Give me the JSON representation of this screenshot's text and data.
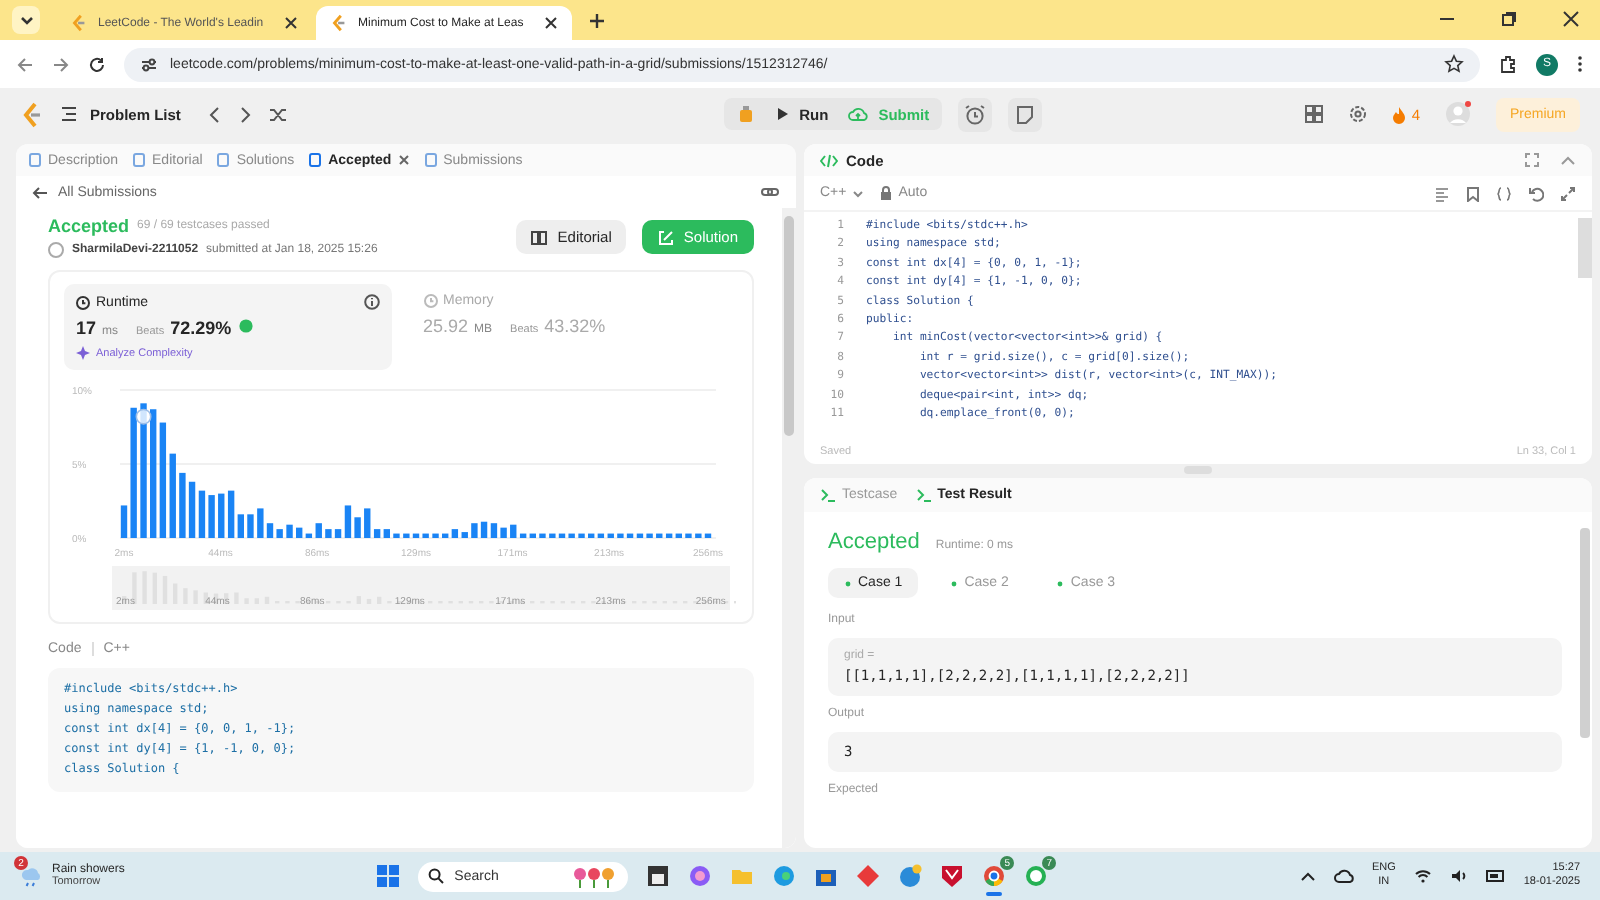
{
  "browser": {
    "tabs": [
      {
        "title": "LeetCode - The World's Leadin",
        "selected": false
      },
      {
        "title": "Minimum Cost to Make at Leas",
        "selected": true
      }
    ],
    "url": "leetcode.com/problems/minimum-cost-to-make-at-least-one-valid-path-in-a-grid/submissions/1512312746/",
    "profile": "S"
  },
  "toolbar": {
    "problem_list": "Problem List",
    "run": "Run",
    "submit": "Submit",
    "streak": "4",
    "premium": "Premium"
  },
  "left_panel": {
    "tabs": [
      {
        "label": "Description",
        "selected": false,
        "closable": false
      },
      {
        "label": "Editorial",
        "selected": false,
        "closable": false
      },
      {
        "label": "Solutions",
        "selected": false,
        "closable": false
      },
      {
        "label": "Accepted",
        "selected": true,
        "closable": true
      },
      {
        "label": "Submissions",
        "selected": false,
        "closable": false
      }
    ],
    "back_link": "All Submissions",
    "submission": {
      "status": "Accepted",
      "testcases": "69 / 69 testcases passed",
      "user": "SharmilaDevi-2211052",
      "submitted": "submitted at Jan 18, 2025 15:26",
      "editorial": "Editorial",
      "solution": "Solution"
    },
    "stats": [
      {
        "label": "Runtime",
        "value": "17",
        "unit": "ms",
        "beats_label": "Beats",
        "beats": "72.29%",
        "selected": true,
        "analyze": "Analyze Complexity"
      },
      {
        "label": "Memory",
        "value": "25.92",
        "unit": "MB",
        "beats_label": "Beats",
        "beats": "43.32%",
        "selected": false
      }
    ],
    "chart_data": {
      "type": "bar",
      "values": [
        2.2,
        8.8,
        9.1,
        8.7,
        7.8,
        5.7,
        4.4,
        3.8,
        3.2,
        2.9,
        3.0,
        3.2,
        1.6,
        1.6,
        2.0,
        1.0,
        0.6,
        0.9,
        0.7,
        0.3,
        1.0,
        0.6,
        0.6,
        2.2,
        1.4,
        2.0,
        0.6,
        0.6,
        0.3,
        0.3,
        0.3,
        0.3,
        0.3,
        0.3,
        0.6,
        0.4,
        1.0,
        1.1,
        1.0,
        0.7,
        0.9,
        0.3,
        0.3,
        0.3,
        0.3,
        0.3,
        0.3,
        0.3,
        0.3,
        0.3,
        0.3,
        0.3,
        0.3,
        0.3,
        0.3,
        0.3,
        0.3,
        0.3,
        0.3,
        0.3,
        0.3
      ],
      "x": [
        2,
        6.2,
        10.5,
        14.7,
        18.9,
        23.2,
        27.4,
        31.6,
        35.9,
        40.1,
        44.3,
        48.6,
        52.8,
        57.0,
        61.3,
        65.5,
        69.7,
        74.0,
        78.2,
        82.4,
        86.7,
        90.9,
        95.1,
        99.4,
        103.6,
        107.8,
        112.1,
        116.3,
        120.5,
        124.8,
        129.0,
        133.2,
        137.5,
        141.7,
        145.9,
        150.2,
        154.4,
        158.6,
        162.9,
        167.1,
        171.3,
        175.6,
        179.8,
        184.0,
        188.3,
        192.5,
        196.7,
        201.0,
        205.2,
        209.4,
        213.7,
        217.9,
        222.1,
        226.4,
        230.6,
        234.8,
        239.1,
        243.3,
        247.5,
        251.8,
        256
      ],
      "xlim": [
        2,
        256
      ],
      "ylim": [
        0,
        10
      ],
      "yticks": [
        {
          "value": 0,
          "label": "0%"
        },
        {
          "value": 5,
          "label": "5%"
        },
        {
          "value": 10,
          "label": "10%"
        }
      ],
      "xticks": [
        {
          "value": 2,
          "label": "2ms"
        },
        {
          "value": 44,
          "label": "44ms"
        },
        {
          "value": 86,
          "label": "86ms"
        },
        {
          "value": 129,
          "label": "129ms"
        },
        {
          "value": 171,
          "label": "171ms"
        },
        {
          "value": 213,
          "label": "213ms"
        },
        {
          "value": 256,
          "label": "256ms"
        }
      ]
    },
    "overview_labels": [
      "2ms",
      "44ms",
      "86ms",
      "129ms",
      "171ms",
      "213ms",
      "256ms"
    ],
    "code": {
      "title": "Code",
      "language": "C++",
      "lines": [
        "#include <bits/stdc++.h>",
        "using namespace std;",
        "const int dx[4] = {0, 0, 1, -1};",
        "const int dy[4] = {1, -1, 0, 0};",
        "class Solution {"
      ]
    }
  },
  "editor": {
    "title": "Code",
    "language": "C++",
    "mode": "Auto",
    "lines": [
      {
        "n": "1",
        "code": "#include <bits/stdc++.h>"
      },
      {
        "n": "2",
        "code": "using namespace std;"
      },
      {
        "n": "3",
        "code": "const int dx[4] = {0, 0, 1, -1};"
      },
      {
        "n": "4",
        "code": "const int dy[4] = {1, -1, 0, 0};"
      },
      {
        "n": "5",
        "code": "class Solution {"
      },
      {
        "n": "6",
        "code": "public:"
      },
      {
        "n": "7",
        "code": "    int minCost(vector<vector<int>>& grid) {"
      },
      {
        "n": "8",
        "code": "        int r = grid.size(), c = grid[0].size();"
      },
      {
        "n": "9",
        "code": "        vector<vector<int>> dist(r, vector<int>(c, INT_MAX));"
      },
      {
        "n": "10",
        "code": "        deque<pair<int, int>> dq;"
      },
      {
        "n": "11",
        "code": "        dq.emplace_front(0, 0);"
      }
    ],
    "saved": "Saved",
    "cursor": "Ln 33, Col 1"
  },
  "test_panel": {
    "tabs": [
      {
        "label": "Testcase",
        "selected": false
      },
      {
        "label": "Test Result",
        "selected": true
      }
    ],
    "status": "Accepted",
    "runtime": "Runtime: 0 ms",
    "cases": [
      {
        "label": "Case 1",
        "selected": true
      },
      {
        "label": "Case 2",
        "selected": false
      },
      {
        "label": "Case 3",
        "selected": false
      }
    ],
    "input_label": "Input",
    "variable": "grid =",
    "input": "[[1,1,1,1],[2,2,2,2],[1,1,1,1],[2,2,2,2]]",
    "output_label": "Output",
    "output": "3",
    "expected_label": "Expected"
  },
  "taskbar": {
    "weather_badge": "2",
    "weather": "Rain showers",
    "weather_sub": "Tomorrow",
    "search": "Search",
    "chrome_badge": "5",
    "whatsapp_badge": "7",
    "lang": "ENG",
    "region": "IN",
    "time": "15:27",
    "date": "18-01-2025"
  }
}
